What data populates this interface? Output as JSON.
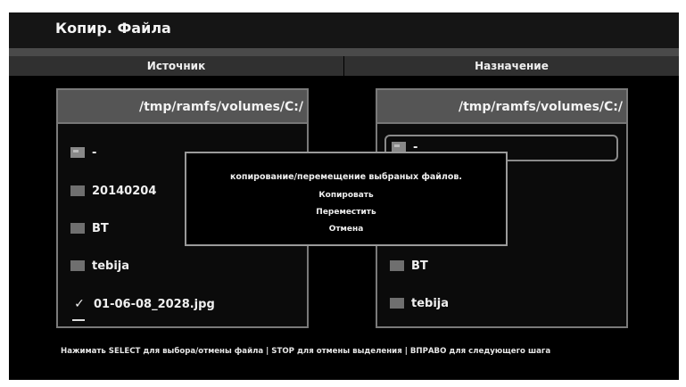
{
  "window": {
    "title": "Копир. Файла"
  },
  "columns": {
    "source": "Источник",
    "destination": "Назначение"
  },
  "left_panel": {
    "path": "/tmp/ramfs/volumes/C:/",
    "items": [
      {
        "label": "-",
        "icon": "parent-folder-icon"
      },
      {
        "label": "20140204",
        "icon": "folder-icon"
      },
      {
        "label": "BT",
        "icon": "folder-icon"
      },
      {
        "label": "tebija",
        "icon": "folder-icon"
      },
      {
        "label": "01-06-08_2028.jpg",
        "icon": "checkmark-icon",
        "checked": true
      }
    ]
  },
  "right_panel": {
    "path": "/tmp/ramfs/volumes/C:/",
    "items": [
      {
        "label": "-",
        "icon": "parent-folder-icon",
        "selected": true
      },
      {
        "label": "BT",
        "icon": "folder-icon"
      },
      {
        "label": "tebija",
        "icon": "folder-icon"
      }
    ]
  },
  "dialog": {
    "message": "копирование/перемещение выбраных файлов.",
    "options": [
      "Копировать",
      "Переместить",
      "Отмена"
    ]
  },
  "footer": {
    "hint": "Нажимать SELECT для выбора/отмены файла | STOP для отмены выделения | ВПРАВО для следующего шага"
  }
}
